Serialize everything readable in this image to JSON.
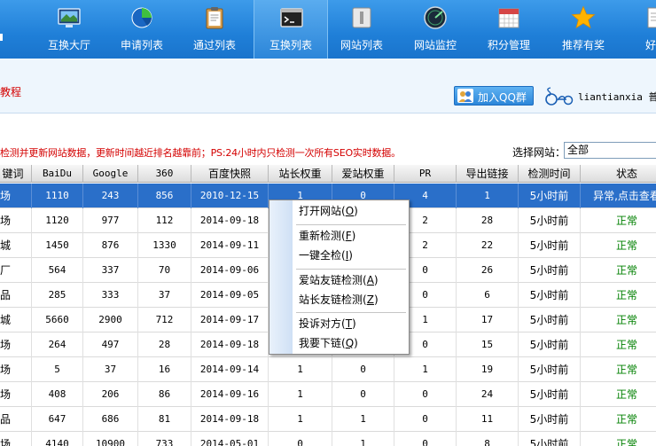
{
  "nav": {
    "items": [
      {
        "label": "互换大厅",
        "icon": "monitor-icon"
      },
      {
        "label": "申请列表",
        "icon": "pie-chart-icon"
      },
      {
        "label": "通过列表",
        "icon": "clipboard-icon"
      },
      {
        "label": "互换列表",
        "icon": "terminal-icon"
      },
      {
        "label": "网站列表",
        "icon": "window-icon"
      },
      {
        "label": "网站监控",
        "icon": "radar-icon"
      },
      {
        "label": "积分管理",
        "icon": "calendar-icon"
      },
      {
        "label": "推荐有奖",
        "icon": "star-icon"
      },
      {
        "label": "好文",
        "icon": "document-icon"
      }
    ],
    "active_index": 3
  },
  "subbar": {
    "title": "教程",
    "qq_button": "加入QQ群",
    "username": "liantianxia 普"
  },
  "notice": "检测并更新网站数据，更新时间越近排名越靠前；PS:24小时内只检测一次所有SEO实时数据。",
  "filter": {
    "label": "选择网站：",
    "selected": "全部"
  },
  "table": {
    "headers": [
      "键词",
      "BaiDu",
      "Google",
      "360",
      "百度快照",
      "站长权重",
      "爱站权重",
      "PR",
      "导出链接",
      "检测时间",
      "状态"
    ],
    "rows": [
      {
        "name": "场",
        "baidu": "1110",
        "google": "243",
        "s360": "856",
        "snapshot": "2010-12-15",
        "zz": "1",
        "az": "0",
        "pr": "4",
        "out": "1",
        "time": "5小时前",
        "status": "异常,点击查看"
      },
      {
        "name": "场",
        "baidu": "1120",
        "google": "977",
        "s360": "112",
        "snapshot": "2014-09-18",
        "zz": "",
        "az": "",
        "pr": "2",
        "out": "28",
        "time": "5小时前",
        "status": "正常"
      },
      {
        "name": "城",
        "baidu": "1450",
        "google": "876",
        "s360": "1330",
        "snapshot": "2014-09-11",
        "zz": "",
        "az": "",
        "pr": "2",
        "out": "22",
        "time": "5小时前",
        "status": "正常"
      },
      {
        "name": "厂",
        "baidu": "564",
        "google": "337",
        "s360": "70",
        "snapshot": "2014-09-06",
        "zz": "",
        "az": "",
        "pr": "0",
        "out": "26",
        "time": "5小时前",
        "status": "正常"
      },
      {
        "name": "品",
        "baidu": "285",
        "google": "333",
        "s360": "37",
        "snapshot": "2014-09-05",
        "zz": "",
        "az": "",
        "pr": "0",
        "out": "6",
        "time": "5小时前",
        "status": "正常"
      },
      {
        "name": "城",
        "baidu": "5660",
        "google": "2900",
        "s360": "712",
        "snapshot": "2014-09-17",
        "zz": "",
        "az": "",
        "pr": "1",
        "out": "17",
        "time": "5小时前",
        "status": "正常"
      },
      {
        "name": "场",
        "baidu": "264",
        "google": "497",
        "s360": "28",
        "snapshot": "2014-09-18",
        "zz": "",
        "az": "",
        "pr": "0",
        "out": "15",
        "time": "5小时前",
        "status": "正常"
      },
      {
        "name": "场",
        "baidu": "5",
        "google": "37",
        "s360": "16",
        "snapshot": "2014-09-14",
        "zz": "1",
        "az": "0",
        "pr": "1",
        "out": "19",
        "time": "5小时前",
        "status": "正常"
      },
      {
        "name": "场",
        "baidu": "408",
        "google": "206",
        "s360": "86",
        "snapshot": "2014-09-16",
        "zz": "1",
        "az": "0",
        "pr": "0",
        "out": "24",
        "time": "5小时前",
        "status": "正常"
      },
      {
        "name": "品",
        "baidu": "647",
        "google": "686",
        "s360": "81",
        "snapshot": "2014-09-18",
        "zz": "1",
        "az": "1",
        "pr": "0",
        "out": "11",
        "time": "5小时前",
        "status": "正常"
      },
      {
        "name": "场",
        "baidu": "4140",
        "google": "10900",
        "s360": "733",
        "snapshot": "2014-05-01",
        "zz": "0",
        "az": "1",
        "pr": "0",
        "out": "8",
        "time": "5小时前",
        "status": "正常"
      }
    ]
  },
  "context_menu": {
    "items": [
      {
        "label": "打开网站",
        "key": "O"
      },
      {
        "label": "重新检测",
        "key": "F"
      },
      {
        "label": "一键全检",
        "key": "I"
      },
      {
        "label": "爱站友链检测",
        "key": "A"
      },
      {
        "label": "站长友链检测",
        "key": "Z"
      },
      {
        "label": "投诉对方",
        "key": "T"
      },
      {
        "label": "我要下链",
        "key": "Q"
      }
    ]
  }
}
